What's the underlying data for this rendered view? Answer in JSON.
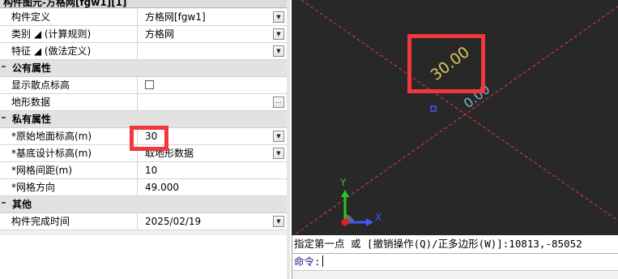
{
  "panel": {
    "title": "构件图元-方格网[fgw1][1]",
    "rows": [
      {
        "label": "构件定义",
        "value": "方格网[fgw1]"
      },
      {
        "label": "类别 ◢ (计算规则)",
        "value": "方格网"
      },
      {
        "label": "特征 ◢ (做法定义)",
        "value": ""
      }
    ],
    "sections": {
      "public": "公有属性",
      "private": "私有属性",
      "other": "其他"
    },
    "public_rows": [
      {
        "label": "显示散点标高",
        "value": ""
      },
      {
        "label": "地形数据",
        "value": ""
      }
    ],
    "private_rows": [
      {
        "label": "*原始地面标高(m)",
        "value": "30"
      },
      {
        "label": "*基底设计标高(m)",
        "value": "取地形数据"
      },
      {
        "label": "*网格间距(m)",
        "value": "10"
      },
      {
        "label": "*网格方向",
        "value": "49.000"
      }
    ],
    "other_rows": [
      {
        "label": "构件完成时间",
        "value": "2025/02/19"
      }
    ],
    "more_glyph": "...",
    "drop_glyph": "▼"
  },
  "viewport": {
    "elevation_label_1": "30.00",
    "elevation_label_2": "0.00",
    "axis_x": "X",
    "axis_y": "Y",
    "background": "#282828",
    "grid_line_color": "#e23b3b",
    "label_1_color": "#d8c55a",
    "label_2_color": "#7fb3c8"
  },
  "command": {
    "line1": "指定第一点 或 [撤销操作(Q)/正多边形(W)]:10813,-85052",
    "prompt": "命令:"
  },
  "colors": {
    "highlight": "#f2383c"
  }
}
